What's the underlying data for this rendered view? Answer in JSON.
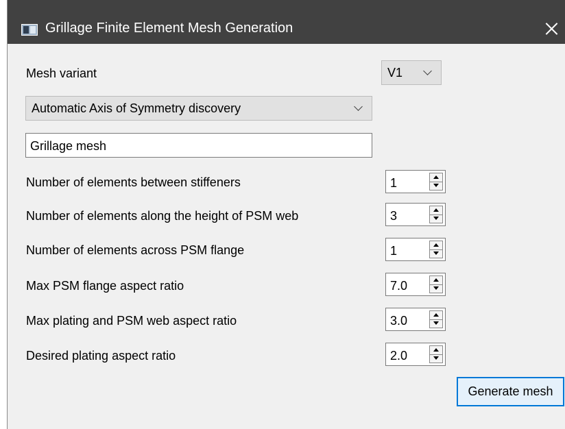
{
  "window": {
    "title": "Grillage Finite Element Mesh Generation"
  },
  "mesh_variant": {
    "label": "Mesh variant",
    "selected": "V1"
  },
  "symmetry": {
    "selected": "Automatic Axis of Symmetry discovery"
  },
  "mesh_name": {
    "value": "Grillage mesh"
  },
  "fields": [
    {
      "label": "Number of elements between stiffeners",
      "value": "1"
    },
    {
      "label": "Number of elements along the height of PSM web",
      "value": "3"
    },
    {
      "label": "Number of elements across PSM flange",
      "value": "1"
    },
    {
      "label": "Max PSM flange aspect ratio",
      "value": "7.0"
    },
    {
      "label": "Max plating and PSM web aspect ratio",
      "value": "3.0"
    },
    {
      "label": "Desired plating aspect ratio",
      "value": "2.0"
    }
  ],
  "actions": {
    "generate_label": "Generate mesh"
  },
  "colors": {
    "titlebar": "#414141",
    "window_bg": "#f0f0f0",
    "accent": "#0078d7"
  }
}
